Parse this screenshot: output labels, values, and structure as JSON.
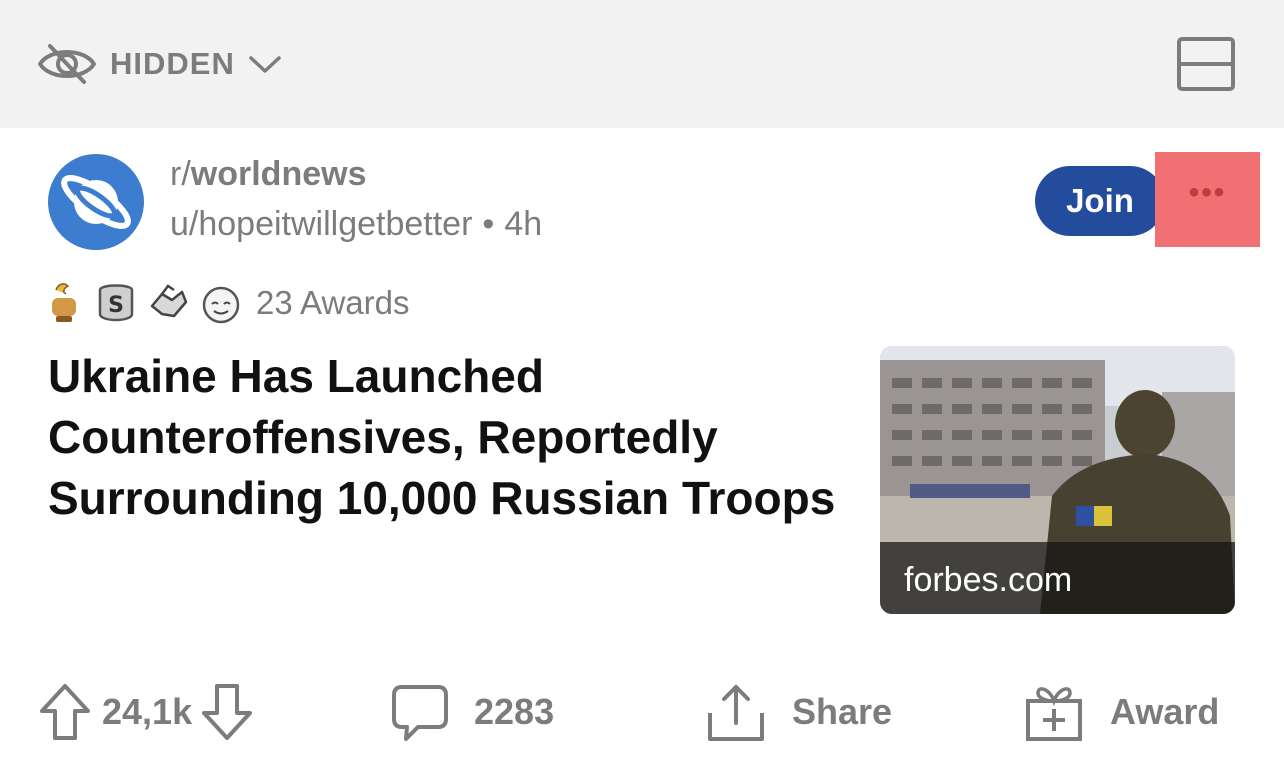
{
  "header": {
    "filter_label": "HIDDEN",
    "filter_icon": "eye-slash-icon",
    "layout_icon": "card-layout-icon"
  },
  "post": {
    "subreddit": "worldnews",
    "subreddit_prefix": "r/",
    "author": "u/hopeitwillgetbetter",
    "separator": "•",
    "age": "4h",
    "join_label": "Join",
    "more_label": "•••",
    "awards_label": "23 Awards",
    "title": "Ukraine Has Launched Counteroffensives, Reportedly Surrounding 10,000 Russian Troops",
    "link_domain": "forbes.com"
  },
  "actions": {
    "upvotes": "24,1k",
    "comments": "2283",
    "share_label": "Share",
    "award_label": "Award"
  },
  "colors": {
    "join_bg": "#244c9c",
    "avatar_bg": "#3c7dd0",
    "more_highlight": "#f07074",
    "muted_text": "#7c7c7c",
    "header_bg": "#f2f2f2"
  }
}
